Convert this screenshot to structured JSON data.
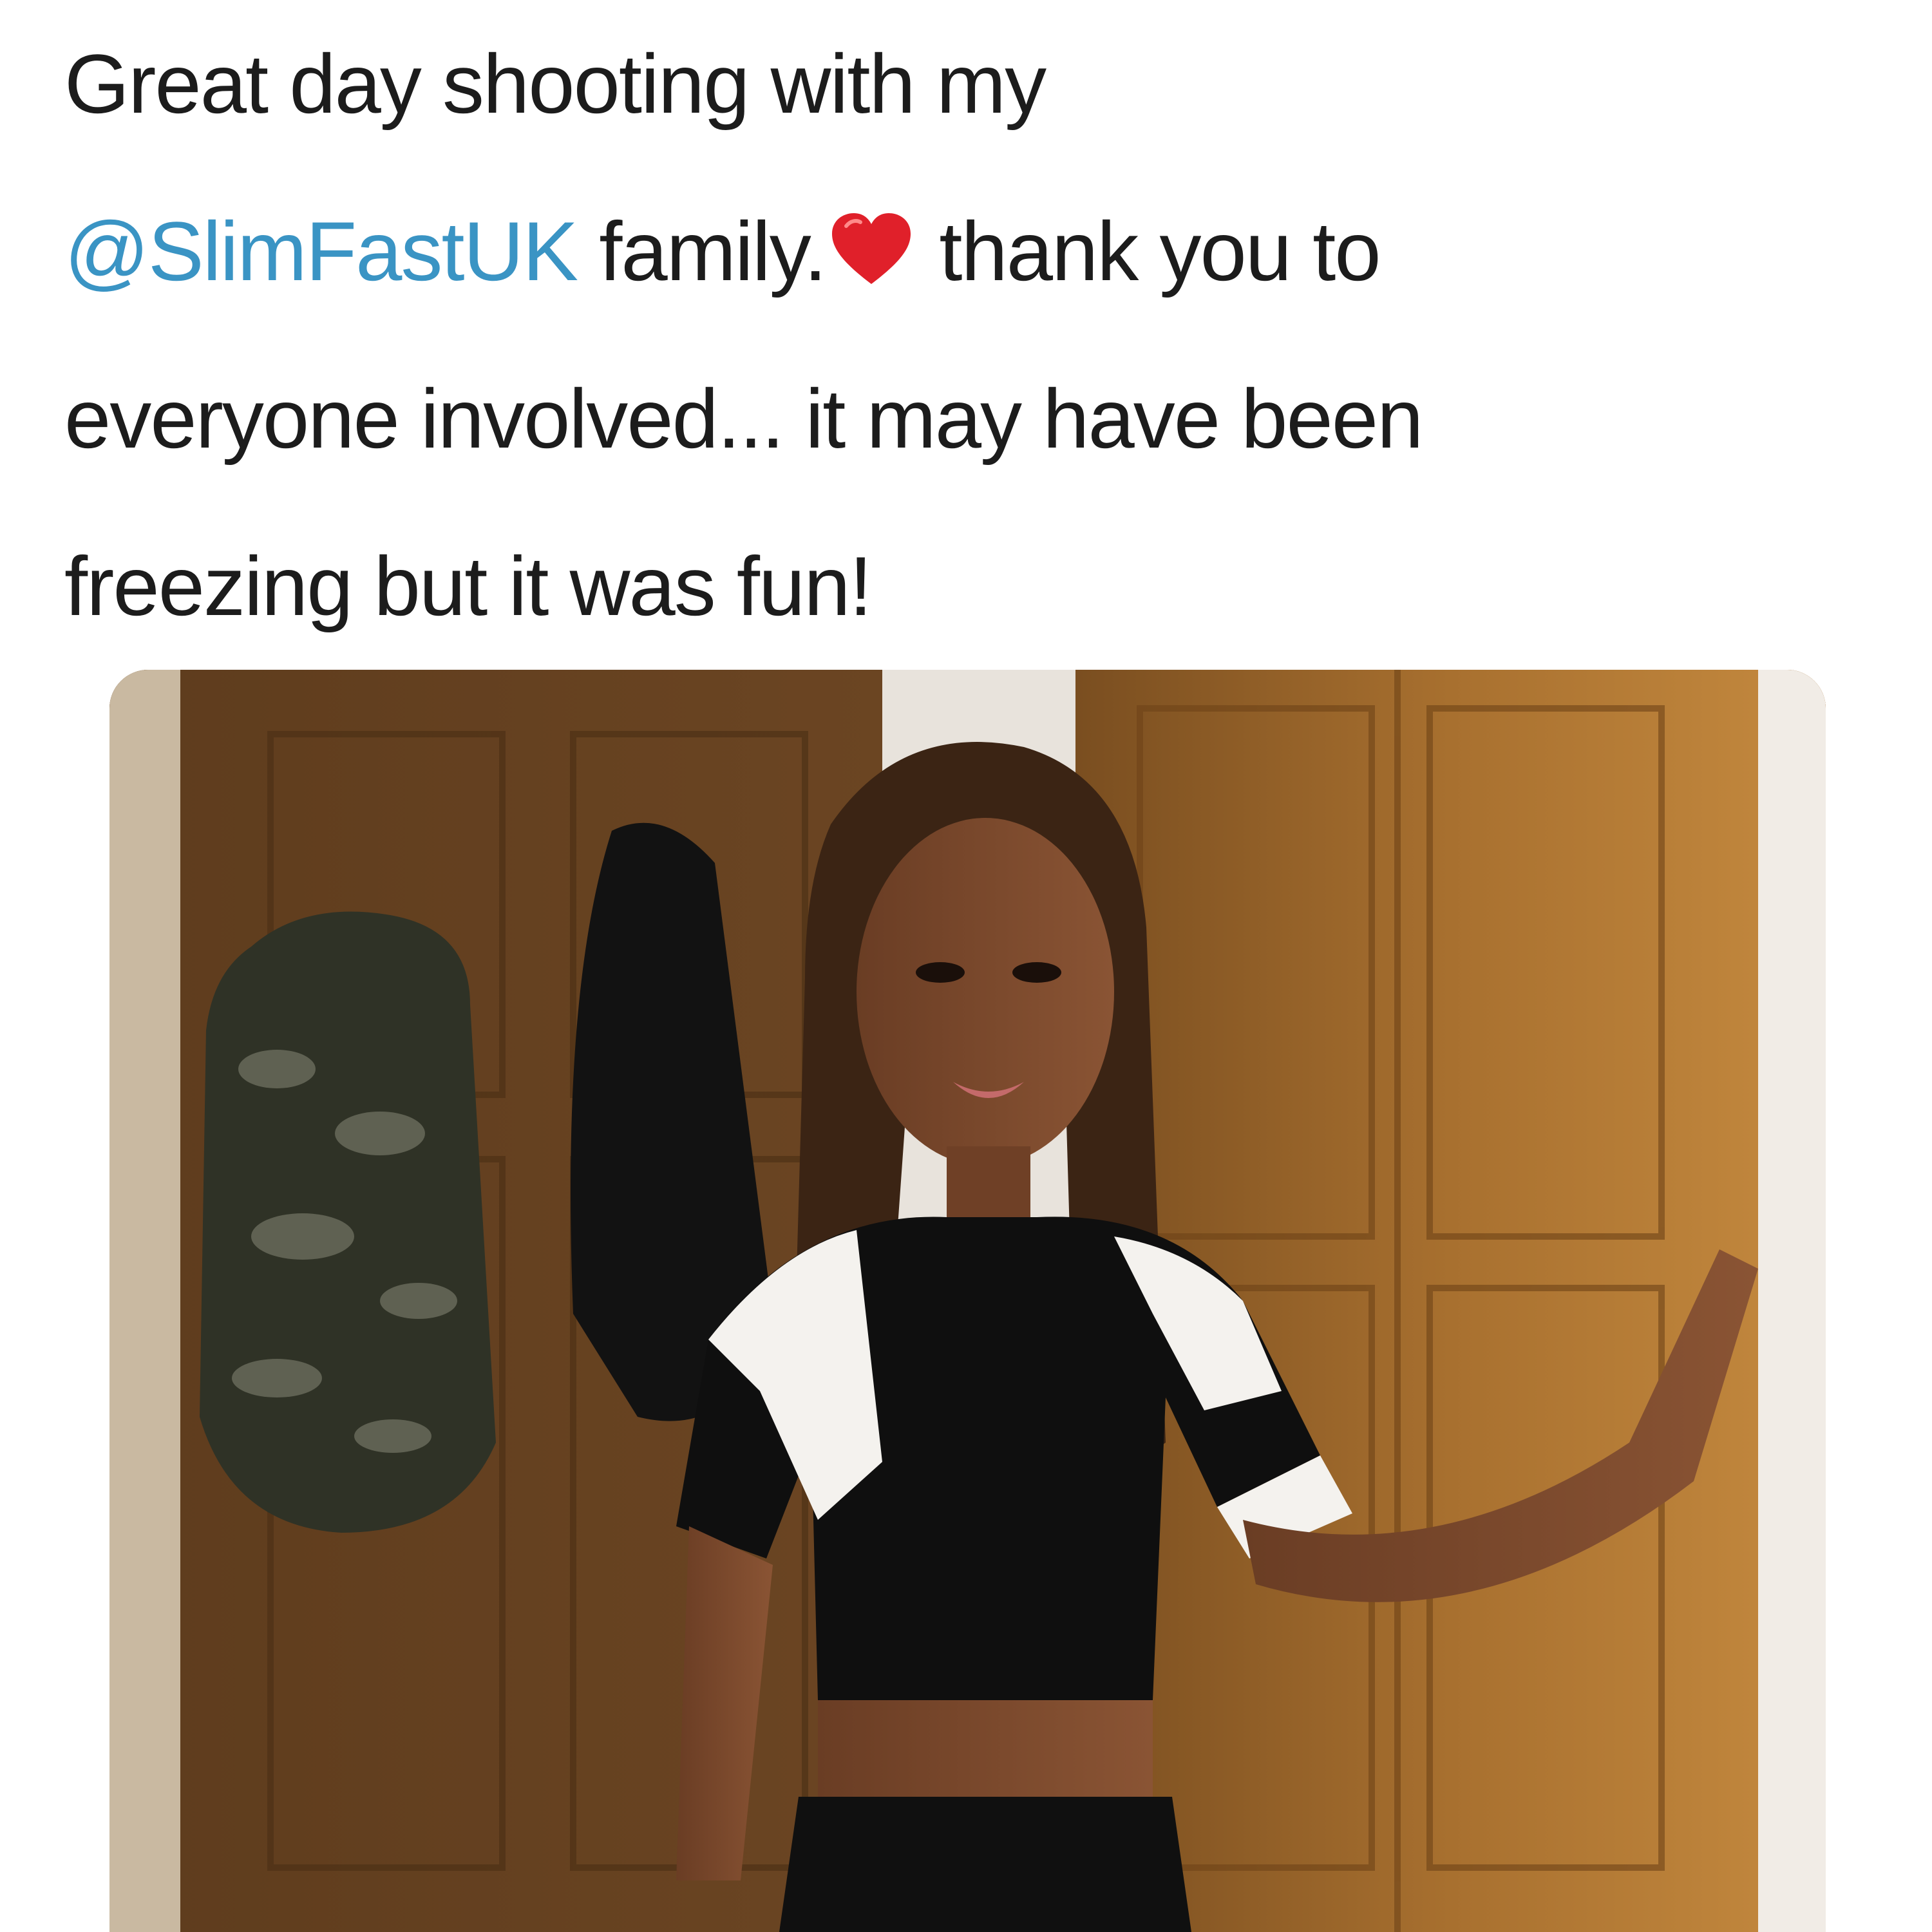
{
  "tweet": {
    "line1": "Great day shooting with my",
    "mention": "@SlimFastUK",
    "line2_after_mention": " family.",
    "emoji_icon": "red-heart-icon",
    "line2_after_emoji": " thank you to",
    "line3": "everyone involved... it may have been",
    "line4": "freezing but it was fun!"
  },
  "colors": {
    "text": "#1c1c1c",
    "mention": "#3a94c4",
    "heart": "#e0202a",
    "background": "#ffffff"
  },
  "media": {
    "kind": "photo",
    "alt": "Woman in a black and white cropped athletic top standing by wooden doors with coats hanging behind her"
  }
}
